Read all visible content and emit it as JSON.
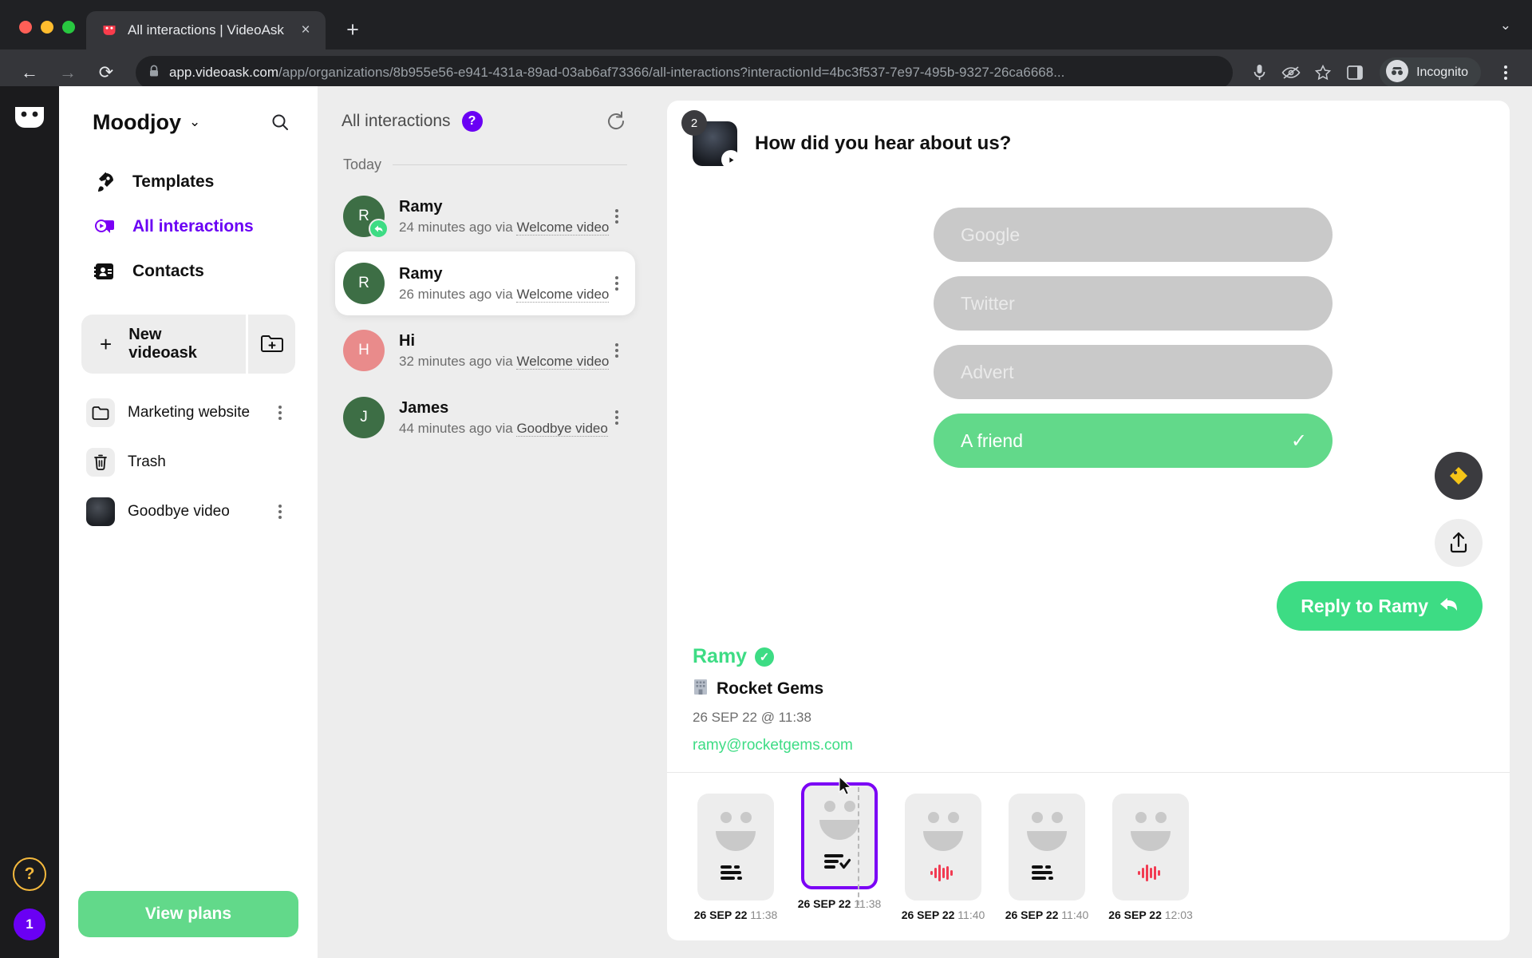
{
  "browser": {
    "tab": {
      "title": "All interactions | VideoAsk",
      "favicon": "videoask-face-icon",
      "close": "×"
    },
    "new_tab_label": "+",
    "tabstrip_chevron": "⌄",
    "url_bold": "app.videoask.com",
    "url_rest": "/app/organizations/8b955e56-e941-431a-89ad-03ab6af73366/all-interactions?interactionId=4bc3f537-7e97-495b-9327-26ca6668...",
    "incognito_label": "Incognito",
    "back_icon": "←",
    "forward_icon": "→",
    "reload_icon": "⟳",
    "lock_icon": "lock-icon"
  },
  "rail": {
    "logo": "videoask-logo",
    "help_label": "?",
    "badge_count": "1"
  },
  "sidebar": {
    "org_name": "Moodjoy",
    "org_chevron": "⌄",
    "search_icon": "search-icon",
    "nav": [
      {
        "label": "Templates",
        "icon": "rocket-icon",
        "active": false
      },
      {
        "label": "All interactions",
        "icon": "videoask-bubble-icon",
        "active": true
      },
      {
        "label": "Contacts",
        "icon": "contacts-icon",
        "active": false
      }
    ],
    "new_videoask": {
      "label": "New videoask",
      "plus": "+",
      "folder_icon": "new-folder-icon"
    },
    "folders": [
      {
        "label": "Marketing website",
        "icon": "folder-icon",
        "type": "folder"
      },
      {
        "label": "Trash",
        "icon": "trash-icon",
        "type": "trash"
      },
      {
        "label": "Goodbye video",
        "icon": "video-thumbnail",
        "type": "video"
      }
    ],
    "view_plans": "View plans"
  },
  "list": {
    "title": "All interactions",
    "help_badge": "?",
    "refresh_icon": "refresh-icon",
    "day_label": "Today",
    "conversations": [
      {
        "name": "Ramy",
        "initial": "R",
        "time": "24 minutes ago",
        "via_prefix": "via",
        "via": "Welcome video",
        "color": "#3d6e45",
        "replied": true,
        "selected": false
      },
      {
        "name": "Ramy",
        "initial": "R",
        "time": "26 minutes ago",
        "via_prefix": "via",
        "via": "Welcome video",
        "color": "#3d6e45",
        "replied": false,
        "selected": true
      },
      {
        "name": "Hi",
        "initial": "H",
        "time": "32 minutes ago",
        "via_prefix": "via",
        "via": "Welcome video",
        "color": "#e98b8b",
        "replied": false,
        "selected": false
      },
      {
        "name": "James",
        "initial": "J",
        "time": "44 minutes ago",
        "via_prefix": "via",
        "via": "Goodbye video",
        "color": "#3d6e45",
        "replied": false,
        "selected": false
      }
    ]
  },
  "detail": {
    "question_number": "2",
    "question": "How did you hear about us?",
    "play_icon": "play-icon",
    "answers": [
      {
        "label": "Google",
        "selected": false
      },
      {
        "label": "Twitter",
        "selected": false
      },
      {
        "label": "Advert",
        "selected": false
      },
      {
        "label": "A friend",
        "selected": true
      }
    ],
    "check_glyph": "✓",
    "tag_button_icon": "tag-icon",
    "share_button_icon": "share-icon",
    "reply_label": "Reply to Ramy",
    "reply_icon": "reply-arrow-icon",
    "person": {
      "name": "Ramy",
      "verified_icon": "verified-check-icon",
      "company_icon": "office-building-icon",
      "company": "Rocket Gems",
      "date": "26 SEP 22 @ 11:38",
      "email": "ramy@rocketgems.com"
    },
    "thumbnails": [
      {
        "date": "26 SEP 22",
        "time": "11:38",
        "type": "text",
        "active": false
      },
      {
        "date": "26 SEP 22",
        "time": "11:38",
        "type": "choice",
        "active": true
      },
      {
        "date": "26 SEP 22",
        "time": "11:40",
        "type": "audio",
        "active": false
      },
      {
        "date": "26 SEP 22",
        "time": "11:40",
        "type": "text",
        "active": false
      },
      {
        "date": "26 SEP 22",
        "time": "12:03",
        "type": "audio",
        "active": false
      }
    ]
  },
  "colors": {
    "accent_purple": "#6a00f4",
    "accent_green": "#3ddc84",
    "muted_green": "#62d98a",
    "audio_red": "#f23b52"
  }
}
